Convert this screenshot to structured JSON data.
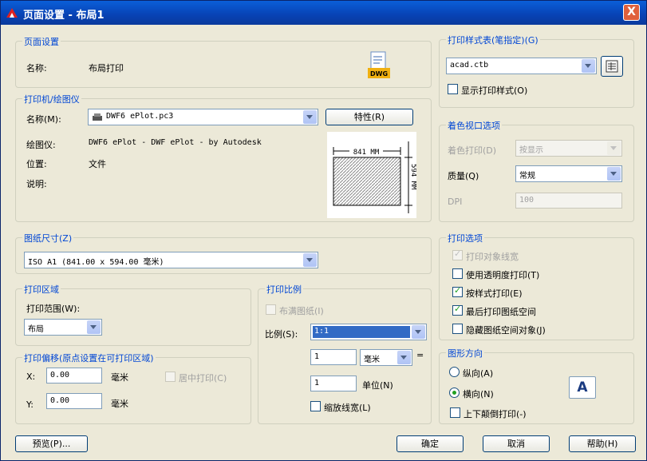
{
  "window": {
    "title": "页面设置 - 布局1",
    "close_label": "X"
  },
  "page_setup": {
    "title": "页面设置",
    "name_label": "名称:",
    "name_value": "布局打印",
    "dwg_badge": "DWG"
  },
  "plotter": {
    "title": "打印机/绘图仪",
    "name_label": "名称(M):",
    "name_value": "DWF6 ePlot.pc3",
    "properties_button": "特性(R)",
    "device_label": "绘图仪:",
    "device_value": "DWF6 ePlot - DWF ePlot - by Autodesk",
    "location_label": "位置:",
    "location_value": "文件",
    "description_label": "说明:",
    "preview_width": "841 MM",
    "preview_height": "594 MM"
  },
  "paper_size": {
    "title": "图纸尺寸(Z)",
    "value": "ISO A1 (841.00 x 594.00 毫米)"
  },
  "plot_area": {
    "title": "打印区域",
    "range_label": "打印范围(W):",
    "range_value": "布局"
  },
  "plot_offset": {
    "title": "打印偏移(原点设置在可打印区域)",
    "x_label": "X:",
    "x_value": "0.00",
    "x_unit": "毫米",
    "y_label": "Y:",
    "y_value": "0.00",
    "y_unit": "毫米",
    "center_label": "居中打印(C)"
  },
  "plot_scale": {
    "title": "打印比例",
    "fit_label": "布满图纸(I)",
    "scale_label": "比例(S):",
    "scale_value": "1:1",
    "value1": "1",
    "unit_value": "毫米",
    "equals": "=",
    "value2": "1",
    "unit_label": "单位(N)",
    "lineweight_label": "缩放线宽(L)"
  },
  "plot_style_table": {
    "title": "打印样式表(笔指定)(G)",
    "value": "acad.ctb",
    "show_label": "显示打印样式(O)"
  },
  "shaded_viewport": {
    "title": "着色视口选项",
    "shade_label": "着色打印(D)",
    "shade_value": "按显示",
    "quality_label": "质量(Q)",
    "quality_value": "常规",
    "dpi_label": "DPI",
    "dpi_value": "100"
  },
  "plot_options": {
    "title": "打印选项",
    "items": [
      {
        "label": "打印对象线宽",
        "checked": true,
        "disabled": true
      },
      {
        "label": "使用透明度打印(T)",
        "checked": false,
        "disabled": false
      },
      {
        "label": "按样式打印(E)",
        "checked": true,
        "disabled": false
      },
      {
        "label": "最后打印图纸空间",
        "checked": true,
        "disabled": false
      },
      {
        "label": "隐藏图纸空间对象(J)",
        "checked": false,
        "disabled": false
      }
    ]
  },
  "orientation": {
    "title": "图形方向",
    "portrait_label": "纵向(A)",
    "landscape_label": "横向(N)",
    "upside_down_label": "上下颠倒打印(-)",
    "preview_letter": "A"
  },
  "buttons": {
    "preview": "预览(P)...",
    "ok": "确定",
    "cancel": "取消",
    "help": "帮助(H)"
  },
  "colors": {
    "titlebar": "#0842b4",
    "group_title": "#0046d5",
    "dialog_bg": "#ece9d8",
    "selection": "#316ac5"
  }
}
